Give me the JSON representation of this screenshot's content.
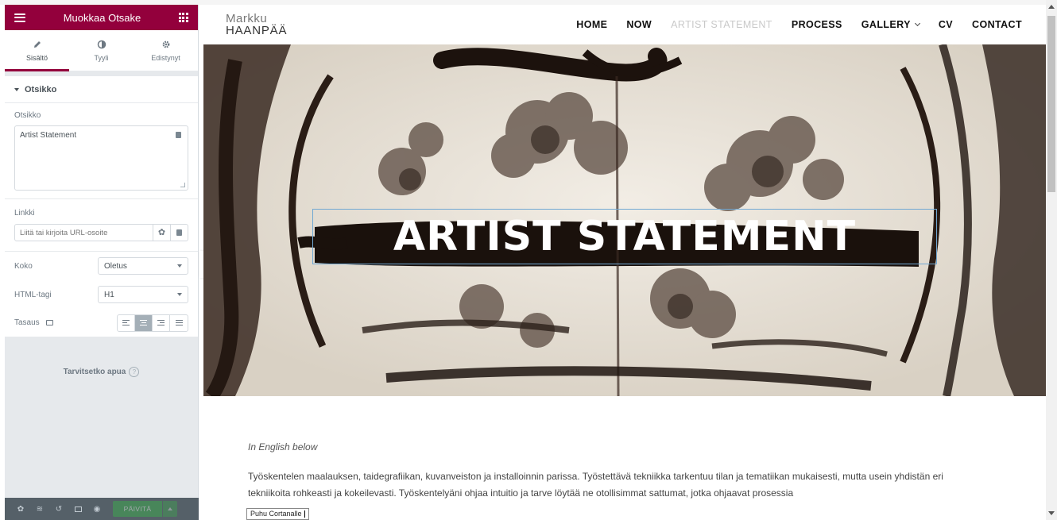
{
  "editor": {
    "header_title": "Muokkaa Otsake",
    "tabs": [
      {
        "label": "Sisältö",
        "icon": "pencil-icon"
      },
      {
        "label": "Tyyli",
        "icon": "contrast-icon"
      },
      {
        "label": "Edistynyt",
        "icon": "gear-icon"
      }
    ],
    "section_title": "Otsikko",
    "title_label": "Otsikko",
    "title_value": "Artist Statement",
    "link_label": "Linkki",
    "link_placeholder": "Liitä tai kirjoita URL-osoite",
    "size_label": "Koko",
    "size_value": "Oletus",
    "html_tag_label": "HTML-tagi",
    "html_tag_value": "H1",
    "align_label": "Tasaus",
    "help_text": "Tarvitsetko apua",
    "update_label": "PÄIVITÄ",
    "accent_color": "#93003c"
  },
  "site": {
    "logo_line1": "Markku",
    "logo_line2": "HAANPÄÄ",
    "nav": [
      {
        "label": "HOME",
        "current": false
      },
      {
        "label": "NOW",
        "current": false
      },
      {
        "label": "ARTIST STATEMENT",
        "current": true
      },
      {
        "label": "PROCESS",
        "current": false
      },
      {
        "label": "GALLERY",
        "current": false,
        "dropdown": true
      },
      {
        "label": "CV",
        "current": false
      },
      {
        "label": "CONTACT",
        "current": false
      }
    ],
    "hero_title": "ARTIST STATEMENT",
    "intro": "In English below",
    "paragraph": "Työskentelen maalauksen, taidegrafiikan, kuvanveiston ja installoinnin parissa. Työstettävä tekniikka tarkentuu tilan ja tematiikan mukaisesti, mutta usein yhdistän eri tekniikoita rohkeasti ja kokeilevasti. Työskentelyäni ohjaa intuitio ja tarve löytää ne otollisimmat sattumat, jotka ohjaavat prosessia"
  },
  "taskbar": {
    "cortana_label": "Puhu Cortanalle"
  }
}
